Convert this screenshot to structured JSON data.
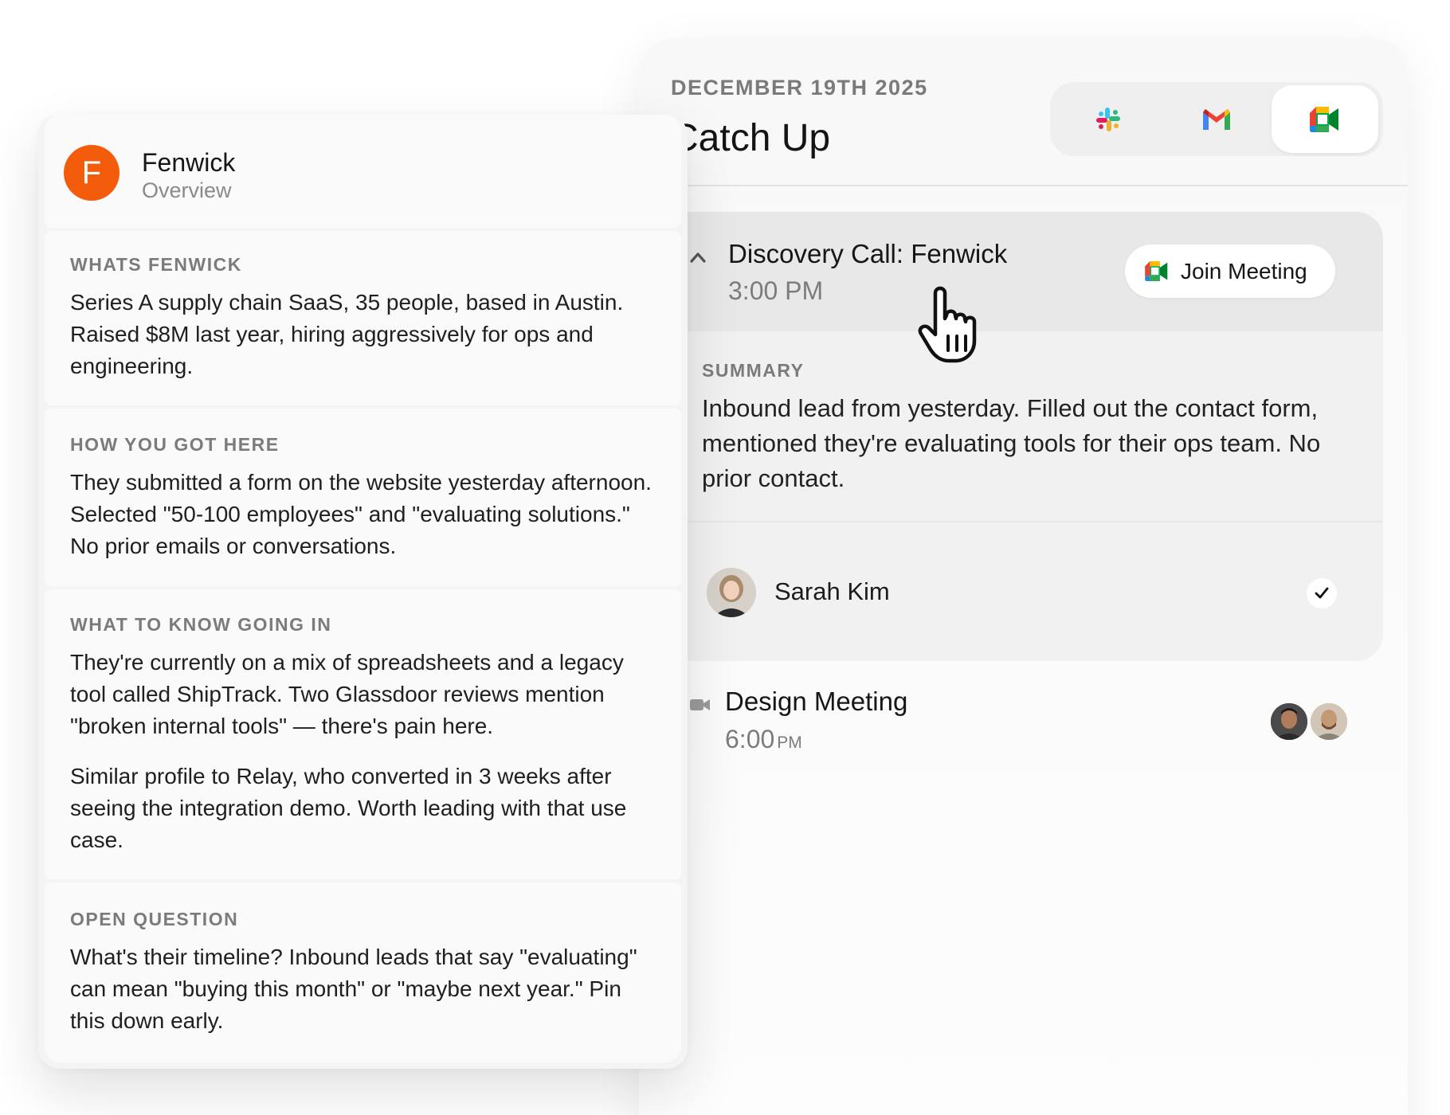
{
  "schedule": {
    "date": "DECEMBER 19TH 2025",
    "title": "Catch Up",
    "apps": [
      {
        "name": "Slack",
        "icon": "slack-icon",
        "active": false
      },
      {
        "name": "Gmail",
        "icon": "gmail-icon",
        "active": false
      },
      {
        "name": "Google Meet",
        "icon": "google-meet-icon",
        "active": true
      }
    ],
    "meetings": [
      {
        "title": "Discovery Call: Fenwick",
        "time": "3:00 PM",
        "expanded": true,
        "join_label": "Join Meeting",
        "summary_label": "SUMMARY",
        "summary": "Inbound lead from yesterday. Filled out the contact form, mentioned they're evaluating tools for their ops team. No prior contact.",
        "attendees": [
          {
            "name": "Sarah Kim",
            "confirmed": true
          }
        ]
      },
      {
        "title": "Design Meeting",
        "time": "6:00",
        "meridiem": "PM",
        "expanded": false
      }
    ]
  },
  "overview": {
    "avatar_letter": "F",
    "company": "Fenwick",
    "subtitle": "Overview",
    "accent": "#F25C0A",
    "sections": [
      {
        "label": "WHATS FENWICK",
        "paragraphs": [
          "Series A supply chain SaaS, 35 people, based in Austin. Raised $8M last year, hiring aggressively for ops and engineering."
        ]
      },
      {
        "label": "HOW YOU GOT HERE",
        "paragraphs": [
          "They submitted a form on the website yesterday afternoon. Selected \"50-100 employees\" and \"evaluating solutions.\" No prior emails or conversations."
        ]
      },
      {
        "label": "WHAT TO KNOW GOING IN",
        "paragraphs": [
          "They're currently on a mix of spreadsheets and a legacy tool called ShipTrack. Two Glassdoor reviews mention \"broken internal tools\" — there's pain here.",
          "Similar profile to Relay, who converted in 3 weeks after seeing the integration demo. Worth leading with that use case."
        ]
      },
      {
        "label": "OPEN QUESTION",
        "paragraphs": [
          "What's their timeline? Inbound leads that say \"evaluating\" can mean \"buying this month\" or \"maybe next year.\" Pin this down early."
        ]
      }
    ]
  }
}
